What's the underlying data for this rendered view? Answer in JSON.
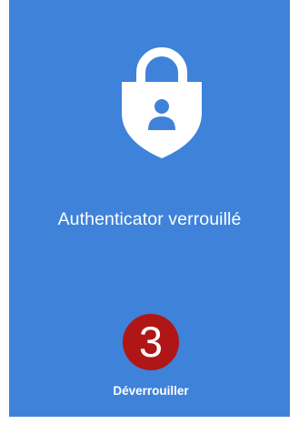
{
  "lock_screen": {
    "icon": "padlock-shield-user-icon",
    "title": "Authenticator verrouillé",
    "unlock_label": "Déverrouiller"
  },
  "annotation": {
    "step_number": "3",
    "badge_color": "#b01616"
  },
  "colors": {
    "background": "#3f82d9",
    "foreground": "#ffffff"
  }
}
